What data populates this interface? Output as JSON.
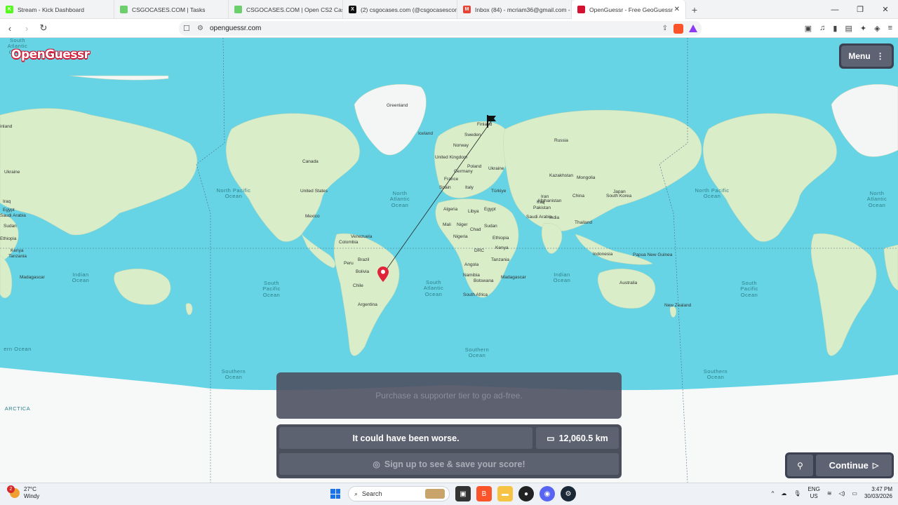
{
  "browser": {
    "tabs": [
      {
        "title": "Stream - Kick Dashboard",
        "favicon_color": "#53fc18",
        "favicon_letter": "K",
        "active": false
      },
      {
        "title": "CSGOCASES.COM | Tasks",
        "favicon_color": "#6ccf6c",
        "favicon_letter": "",
        "active": false
      },
      {
        "title": "CSGOCASES.COM | Open CS2 Cases",
        "favicon_color": "#6ccf6c",
        "favicon_letter": "",
        "active": false
      },
      {
        "title": "(2) csgocases.com (@csgocasescom)",
        "favicon_color": "#111111",
        "favicon_letter": "X",
        "active": false
      },
      {
        "title": "Inbox (84) - mcriam36@gmail.com -",
        "favicon_color": "#ea4335",
        "favicon_letter": "M",
        "active": false
      },
      {
        "title": "OpenGuessr - Free GeoGuessr",
        "favicon_color": "#d2122e",
        "favicon_letter": "",
        "active": true
      }
    ],
    "new_tab": "+",
    "address": "openguessr.com"
  },
  "app": {
    "logo": "OpenGuessr",
    "menu_label": "Menu",
    "ad_text": "Purchase a supporter tier to go ad-free.",
    "result_message": "It could have been worse.",
    "distance": "12,060.5 km",
    "signup_text": "Sign up to see & save your score!",
    "continue_label": "Continue"
  },
  "map": {
    "labels": [
      {
        "text": "Greenland"
      },
      {
        "text": "Iceland"
      },
      {
        "text": "Finland"
      },
      {
        "text": "Sweden"
      },
      {
        "text": "Norway"
      },
      {
        "text": "United Kingdom"
      },
      {
        "text": "Poland"
      },
      {
        "text": "Germany"
      },
      {
        "text": "France"
      },
      {
        "text": "Ukraine"
      },
      {
        "text": "Spain"
      },
      {
        "text": "Italy"
      },
      {
        "text": "Türkiye"
      },
      {
        "text": "Algeria"
      },
      {
        "text": "Libya"
      },
      {
        "text": "Egypt"
      },
      {
        "text": "Mali"
      },
      {
        "text": "Niger"
      },
      {
        "text": "Chad"
      },
      {
        "text": "Sudan"
      },
      {
        "text": "Nigeria"
      },
      {
        "text": "Ethiopia"
      },
      {
        "text": "DRC"
      },
      {
        "text": "Kenya"
      },
      {
        "text": "Tanzania"
      },
      {
        "text": "Angola"
      },
      {
        "text": "Namibia"
      },
      {
        "text": "Botswana"
      },
      {
        "text": "South Africa"
      },
      {
        "text": "Madagascar"
      },
      {
        "text": "Russia"
      },
      {
        "text": "Kazakhstan"
      },
      {
        "text": "Mongolia"
      },
      {
        "text": "China"
      },
      {
        "text": "Japan"
      },
      {
        "text": "South Korea"
      },
      {
        "text": "Iran"
      },
      {
        "text": "Iraq"
      },
      {
        "text": "Saudi Arabia"
      },
      {
        "text": "Afghanistan"
      },
      {
        "text": "Pakistan"
      },
      {
        "text": "India"
      },
      {
        "text": "Thailand"
      },
      {
        "text": "Indonesia"
      },
      {
        "text": "Papua New Guinea"
      },
      {
        "text": "Australia"
      },
      {
        "text": "New Zealand"
      },
      {
        "text": "Canada"
      },
      {
        "text": "United States"
      },
      {
        "text": "Mexico"
      },
      {
        "text": "Venezuela"
      },
      {
        "text": "Colombia"
      },
      {
        "text": "Peru"
      },
      {
        "text": "Brazil"
      },
      {
        "text": "Bolivia"
      },
      {
        "text": "Chile"
      },
      {
        "text": "Argentina"
      },
      {
        "text": "Saudi Arabia"
      },
      {
        "text": "Egypt"
      },
      {
        "text": "Sudan"
      },
      {
        "text": "Ethiopia"
      },
      {
        "text": "Kenya"
      },
      {
        "text": "Tanzania"
      },
      {
        "text": "Madagascar"
      },
      {
        "text": "inland"
      },
      {
        "text": "Ukraine"
      },
      {
        "text": "Iraq"
      }
    ],
    "oceans": [
      {
        "text": "North Pacific Ocean"
      },
      {
        "text": "North Atlantic Ocean"
      },
      {
        "text": "South Atlantic Ocean"
      },
      {
        "text": "Indian Ocean"
      },
      {
        "text": "South Pacific Ocean"
      },
      {
        "text": "Southern Ocean"
      },
      {
        "text": "Southern Ocean"
      },
      {
        "text": "Indian Ocean"
      },
      {
        "text": "North Pacific Ocean"
      },
      {
        "text": "South Pacific Ocean"
      },
      {
        "text": "Southern Ocean"
      },
      {
        "text": "North Atlantic Ocean"
      },
      {
        "text": "South Atlantic Ocean"
      },
      {
        "text": "ARCTICA"
      },
      {
        "text": "ern Ocean"
      }
    ]
  },
  "taskbar": {
    "weather_temp": "27°C",
    "weather_desc": "Windy",
    "weather_badge": "2",
    "search_placeholder": "Search",
    "lang_top": "ENG",
    "lang_bottom": "US",
    "time": "3:47 PM",
    "date": "30/03/2026"
  },
  "colors": {
    "ocean": "#66d4e4",
    "land": "#d8ecc8",
    "panel": "#4a4f5c",
    "pin": "#e0243a"
  }
}
